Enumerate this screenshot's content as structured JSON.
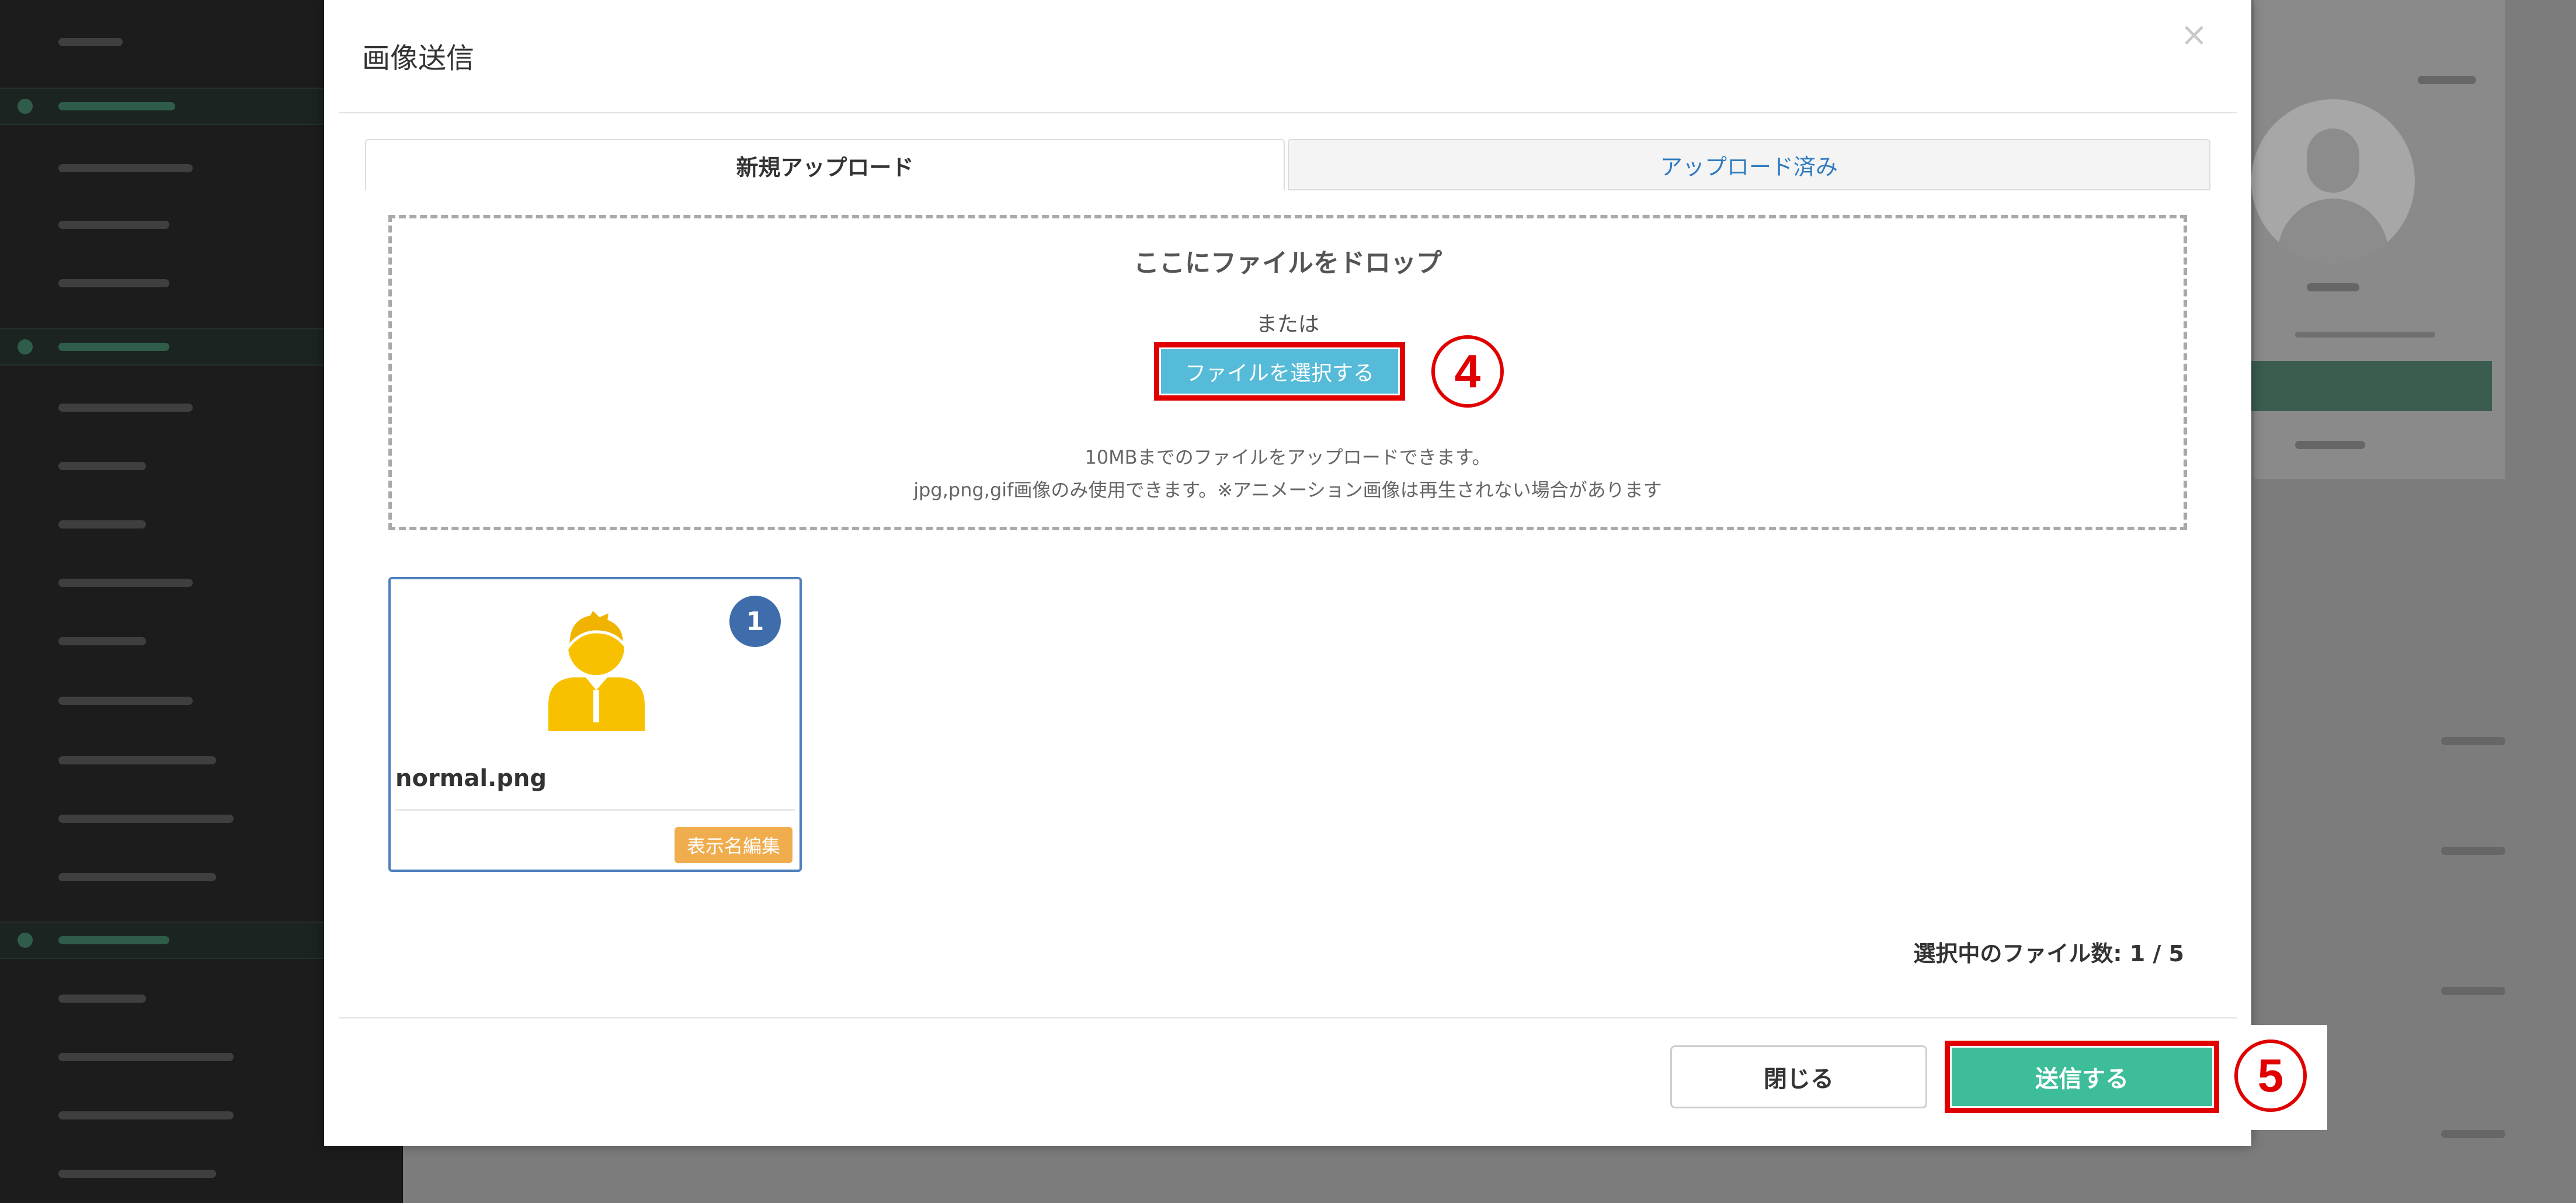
{
  "modal": {
    "title": "画像送信",
    "close_glyph": "×",
    "tabs": [
      {
        "label": "新規アップロード",
        "active": true
      },
      {
        "label": "アップロード済み",
        "active": false
      }
    ],
    "dropzone": {
      "title": "ここにファイルをドロップ",
      "or_text": "または",
      "select_button_label": "ファイルを選択する",
      "note_size": "10MBまでのファイルをアップロードできます。",
      "note_format": "jpg,png,gif画像のみ使用できます。※アニメーション画像は再生されない場合があります"
    },
    "files": [
      {
        "name": "normal.png",
        "order": "1",
        "edit_label": "表示名編集",
        "icon": "user-avatar-icon"
      }
    ],
    "selected_count_text": "選択中のファイル数: 1 / 5",
    "footer": {
      "close_label": "閉じる",
      "send_label": "送信する"
    }
  },
  "annotations": {
    "select_step": "4",
    "send_step": "5",
    "highlight_color": "#e00000"
  },
  "colors": {
    "select_button": "#56bbd9",
    "send_button": "#3ebd9a",
    "edit_button": "#f0ad4e",
    "count_badge": "#3f6dac",
    "inactive_tab_text": "#2f7bbf"
  }
}
